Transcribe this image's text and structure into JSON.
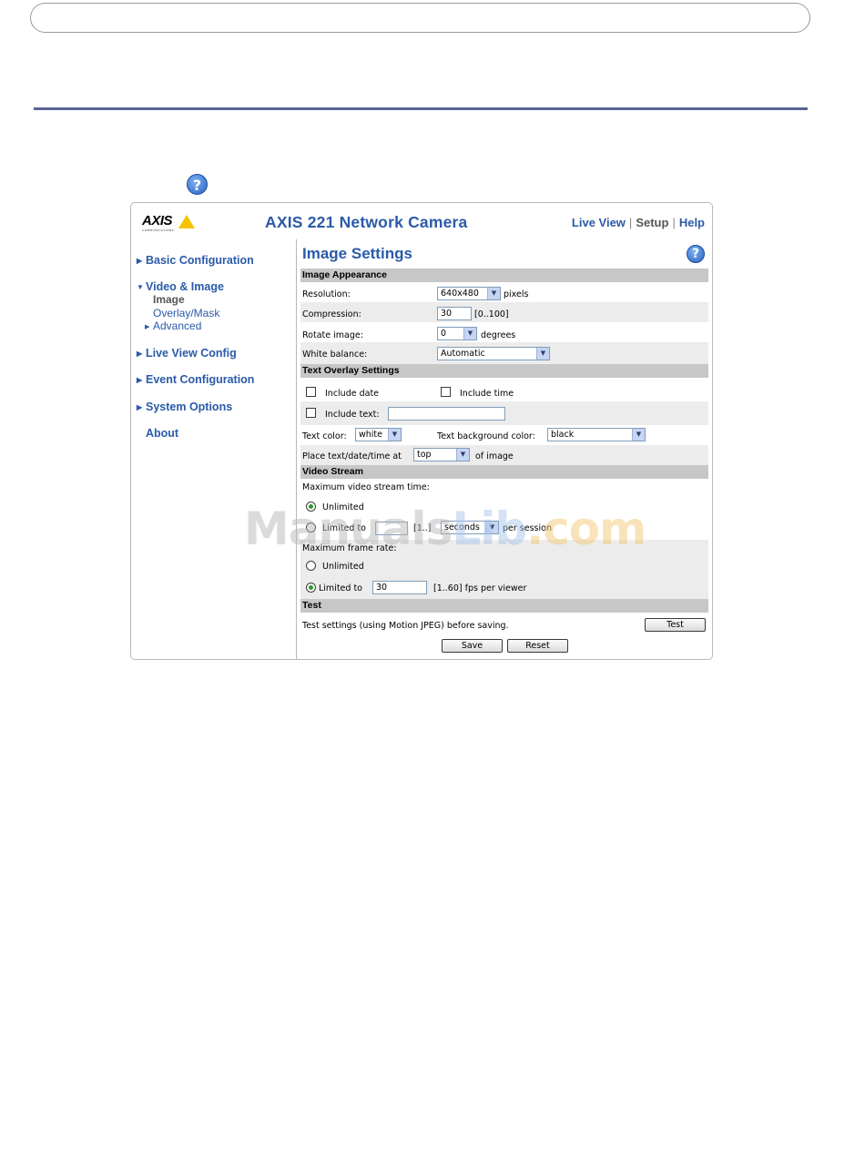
{
  "help_icon": "help-icon",
  "header": {
    "logo_text": "AXIS",
    "logo_subtext": "COMMUNICATIONS",
    "title": "AXIS 221 Network Camera",
    "nav": [
      {
        "label": "Live View"
      },
      {
        "label": "Setup"
      },
      {
        "label": "Help"
      }
    ],
    "sep": "|"
  },
  "sidebar": {
    "basic": "Basic Configuration",
    "video": "Video & Image",
    "video_items": [
      "Image",
      "Overlay/Mask",
      "Advanced"
    ],
    "live": "Live View Config",
    "event": "Event Configuration",
    "system": "System Options",
    "about": "About"
  },
  "page": {
    "title": "Image Settings",
    "appearance": {
      "heading": "Image Appearance",
      "resolution_label": "Resolution:",
      "resolution_value": "640x480",
      "resolution_unit": "pixels",
      "compression_label": "Compression:",
      "compression_value": "30",
      "compression_range": "[0..100]",
      "rotate_label": "Rotate image:",
      "rotate_value": "0",
      "rotate_unit": "degrees",
      "wb_label": "White balance:",
      "wb_value": "Automatic"
    },
    "overlay": {
      "heading": "Text Overlay Settings",
      "include_date": "Include date",
      "include_time": "Include time",
      "include_text": "Include text:",
      "include_text_value": "",
      "text_color_label": "Text color:",
      "text_color_value": "white",
      "bg_color_label": "Text background color:",
      "bg_color_value": "black",
      "place_label": "Place text/date/time at",
      "place_value": "top",
      "place_suffix": "of image"
    },
    "stream": {
      "heading": "Video Stream",
      "max_time_label": "Maximum video stream time:",
      "unlimited": "Unlimited",
      "limited_to": "Limited to",
      "time_value": "",
      "time_range": "[1..]",
      "time_unit": "seconds",
      "per_session": "per session",
      "max_rate_label": "Maximum frame rate:",
      "rate_unlimited": "Unlimited",
      "rate_limited_to": "Limited to",
      "rate_value": "30",
      "rate_range": "[1..60] fps per viewer"
    },
    "test": {
      "heading": "Test",
      "text": "Test settings (using Motion JPEG) before saving.",
      "button": "Test"
    },
    "save": "Save",
    "reset": "Reset"
  },
  "watermark": {
    "a": "Manuals",
    "b": "Lib",
    "c": ".com"
  }
}
